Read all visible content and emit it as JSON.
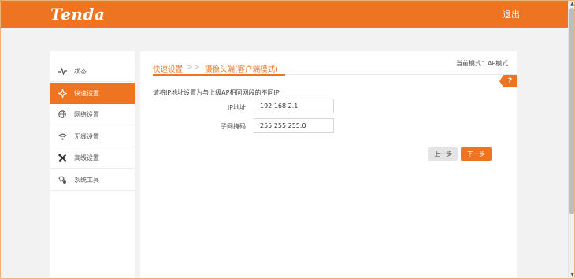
{
  "header": {
    "logo": "Tenda",
    "logout": "退出"
  },
  "sidebar": {
    "items": [
      {
        "label": "状态",
        "icon": "pulse-icon"
      },
      {
        "label": "快速设置",
        "icon": "star-icon",
        "active": true
      },
      {
        "label": "网络设置",
        "icon": "globe-icon"
      },
      {
        "label": "无线设置",
        "icon": "wifi-icon"
      },
      {
        "label": "高级设置",
        "icon": "tools-icon"
      },
      {
        "label": "系统工具",
        "icon": "gears-icon"
      }
    ]
  },
  "main": {
    "breadcrumb": {
      "first": "快速设置",
      "separator": ">>",
      "second": "摄像头端(客户端模式)"
    },
    "mode_text": "当前模式：AP模式",
    "help_label": "?",
    "description": "请将IP地址设置为与上级AP相同网段的不同IP",
    "fields": {
      "ip": {
        "label": "IP地址",
        "value": "192.168.2.1"
      },
      "mask": {
        "label": "子网掩码",
        "value": "255.255.255.0"
      }
    },
    "buttons": {
      "prev": "上一步",
      "next": "下一步"
    }
  },
  "colors": {
    "accent": "#ee7422",
    "background": "#f2f2f2"
  }
}
